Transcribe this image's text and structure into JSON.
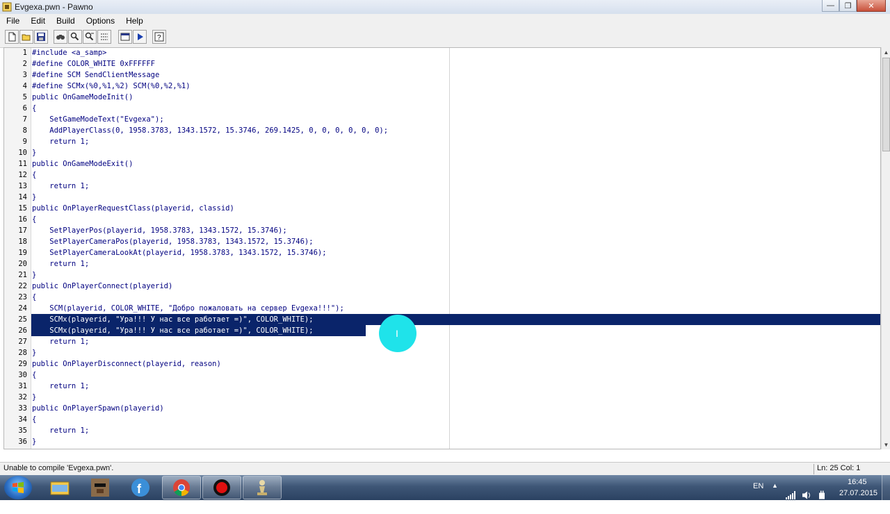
{
  "window": {
    "title": "Evgexa.pwn - Pawno",
    "minimize_icon": "minimize-icon",
    "maximize_icon": "restore-icon",
    "close_icon": "close-icon"
  },
  "menu": [
    "File",
    "Edit",
    "Build",
    "Options",
    "Help"
  ],
  "toolbar": [
    "new-file-icon",
    "open-file-icon",
    "save-icon",
    "find-icon",
    "find-next-icon",
    "replace-icon",
    "function-list-icon",
    "compile-run-icon",
    "help-icon"
  ],
  "code_lines": [
    "#include <a_samp>",
    "#define COLOR_WHITE 0xFFFFFF",
    "#define SCM SendClientMessage",
    "#define SCMx(%0,%1,%2) SCM(%0,%2,%1)",
    "public OnGameModeInit()",
    "{",
    "    SetGameModeText(\"Evgexa\");",
    "    AddPlayerClass(0, 1958.3783, 1343.1572, 15.3746, 269.1425, 0, 0, 0, 0, 0, 0);",
    "    return 1;",
    "}",
    "public OnGameModeExit()",
    "{",
    "    return 1;",
    "}",
    "public OnPlayerRequestClass(playerid, classid)",
    "{",
    "    SetPlayerPos(playerid, 1958.3783, 1343.1572, 15.3746);",
    "    SetPlayerCameraPos(playerid, 1958.3783, 1343.1572, 15.3746);",
    "    SetPlayerCameraLookAt(playerid, 1958.3783, 1343.1572, 15.3746);",
    "    return 1;",
    "}",
    "public OnPlayerConnect(playerid)",
    "{",
    "    SCM(playerid, COLOR_WHITE, \"Добро пожаловать на сервер Evgexa!!!\");",
    "    SCMx(playerid, \"Ура!!! У нас все работает =)\", COLOR_WHITE);",
    "    SCMx(playerid, \"Ура!!! У нас все работает =)\", COLOR_WHITE);",
    "    return 1;",
    "}",
    "public OnPlayerDisconnect(playerid, reason)",
    "{",
    "    return 1;",
    "}",
    "public OnPlayerSpawn(playerid)",
    "{",
    "    return 1;",
    "}"
  ],
  "selected_lines": [
    25,
    26
  ],
  "status": {
    "message": "Unable to compile 'Evgexa.pwn'.",
    "position": "Ln: 25  Col: 1"
  },
  "taskbar": {
    "apps": [
      "explorer-icon",
      "game-avatar-icon",
      "facebook-icon",
      "chrome-icon",
      "record-icon",
      "pawno-icon"
    ],
    "language": "EN",
    "time": "16:45",
    "date": "27.07.2015"
  },
  "colors": {
    "keyword": "#000080",
    "selection": "#0a246a",
    "cursor_highlight": "#1fe3ea"
  }
}
